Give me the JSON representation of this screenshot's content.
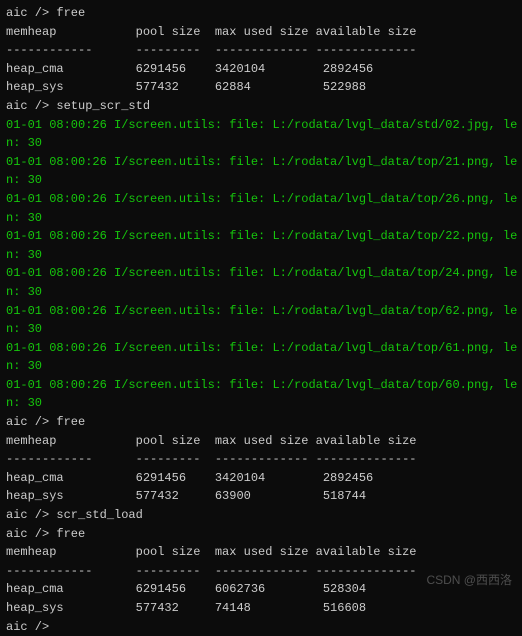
{
  "block1": {
    "prompt1": "aic /> free",
    "header": "memheap           pool size  max used size available size",
    "divider": "------------      ---------  ------------- --------------",
    "rows": [
      "heap_cma          6291456    3420104        2892456",
      "heap_sys          577432     62884          522988"
    ],
    "prompt2": "aic /> setup_scr_std"
  },
  "logs": [
    {
      "l1": "01-01 08:00:26 I/screen.utils: file: L:/rodata/lvgl_data/std/02.jpg, le",
      "l2": "n: 30"
    },
    {
      "l1": "01-01 08:00:26 I/screen.utils: file: L:/rodata/lvgl_data/top/21.png, le",
      "l2": "n: 30"
    },
    {
      "l1": "01-01 08:00:26 I/screen.utils: file: L:/rodata/lvgl_data/top/26.png, le",
      "l2": "n: 30"
    },
    {
      "l1": "01-01 08:00:26 I/screen.utils: file: L:/rodata/lvgl_data/top/22.png, le",
      "l2": "n: 30"
    },
    {
      "l1": "01-01 08:00:26 I/screen.utils: file: L:/rodata/lvgl_data/top/24.png, le",
      "l2": "n: 30"
    },
    {
      "l1": "01-01 08:00:26 I/screen.utils: file: L:/rodata/lvgl_data/top/62.png, le",
      "l2": "n: 30"
    },
    {
      "l1": "01-01 08:00:26 I/screen.utils: file: L:/rodata/lvgl_data/top/61.png, le",
      "l2": "n: 30"
    },
    {
      "l1": "01-01 08:00:26 I/screen.utils: file: L:/rodata/lvgl_data/top/60.png, le",
      "l2": "n: 30"
    }
  ],
  "block2": {
    "prompt1": "aic /> free",
    "header": "memheap           pool size  max used size available size",
    "divider": "------------      ---------  ------------- --------------",
    "rows": [
      "heap_cma          6291456    3420104        2892456",
      "heap_sys          577432     63900          518744"
    ],
    "prompt2": "aic /> scr_std_load"
  },
  "block3": {
    "prompt1": "aic /> free",
    "header": "memheap           pool size  max used size available size",
    "divider": "------------      ---------  ------------- --------------",
    "rows": [
      "heap_cma          6291456    6062736        528304",
      "heap_sys          577432     74148          516608"
    ],
    "prompt2": "aic /> "
  },
  "watermark": "CSDN @西西洛"
}
